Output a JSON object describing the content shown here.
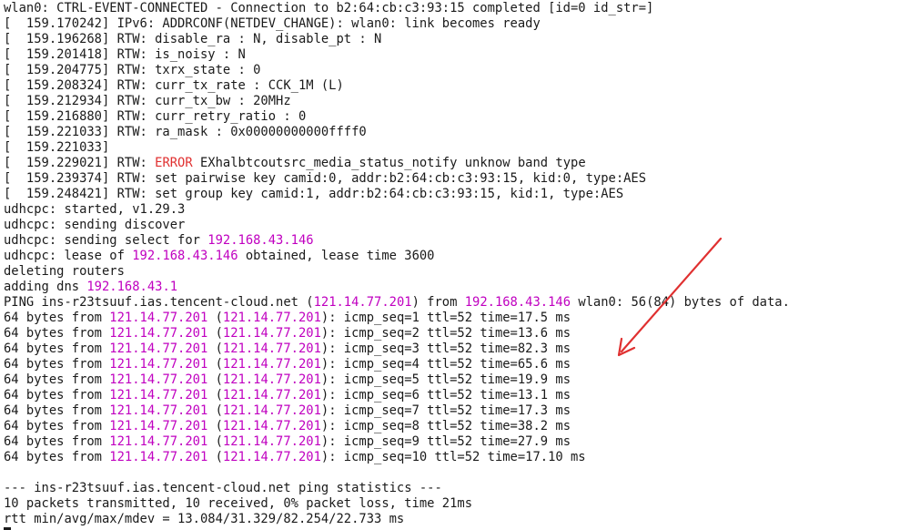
{
  "colors": {
    "text": "#1a1a1a",
    "ip_highlight": "#c000c0",
    "error": "#e03030",
    "arrow": "#e03030",
    "background": "#ffffff"
  },
  "terminal": {
    "lines": [
      [
        {
          "t": "wlan0: CTRL-EVENT-CONNECTED - Connection to b2:64:cb:c3:93:15 completed [id=0 id_str=]"
        }
      ],
      [
        {
          "t": "[  159.170242] IPv6: ADDRCONF(NETDEV_CHANGE): wlan0: link becomes ready"
        }
      ],
      [
        {
          "t": "[  159.196268] RTW: disable_ra : N, disable_pt : N"
        }
      ],
      [
        {
          "t": "[  159.201418] RTW: is_noisy : N"
        }
      ],
      [
        {
          "t": "[  159.204775] RTW: txrx_state : 0"
        }
      ],
      [
        {
          "t": "[  159.208324] RTW: curr_tx_rate : CCK_1M (L)"
        }
      ],
      [
        {
          "t": "[  159.212934] RTW: curr_tx_bw : 20MHz"
        }
      ],
      [
        {
          "t": "[  159.216880] RTW: curr_retry_ratio : 0"
        }
      ],
      [
        {
          "t": "[  159.221033] RTW: ra_mask : 0x00000000000ffff0"
        }
      ],
      [
        {
          "t": "[  159.221033]"
        }
      ],
      [
        {
          "t": "[  159.229021] RTW: "
        },
        {
          "t": "ERROR",
          "c": "error"
        },
        {
          "t": " EXhalbtcoutsrc_media_status_notify unknow band type"
        }
      ],
      [
        {
          "t": "[  159.239374] RTW: set pairwise key camid:0, addr:b2:64:cb:c3:93:15, kid:0, type:AES"
        }
      ],
      [
        {
          "t": "[  159.248421] RTW: set group key camid:1, addr:b2:64:cb:c3:93:15, kid:1, type:AES"
        }
      ],
      [
        {
          "t": "udhcpc: started, v1.29.3"
        }
      ],
      [
        {
          "t": "udhcpc: sending discover"
        }
      ],
      [
        {
          "t": "udhcpc: sending select for "
        },
        {
          "t": "192.168.43.146",
          "c": "ip"
        }
      ],
      [
        {
          "t": "udhcpc: lease of "
        },
        {
          "t": "192.168.43.146",
          "c": "ip"
        },
        {
          "t": " obtained, lease time 3600"
        }
      ],
      [
        {
          "t": "deleting routers"
        }
      ],
      [
        {
          "t": "adding dns "
        },
        {
          "t": "192.168.43.1",
          "c": "ip"
        }
      ],
      [
        {
          "t": "PING ins-r23tsuuf.ias.tencent-cloud.net ("
        },
        {
          "t": "121.14.77.201",
          "c": "ip"
        },
        {
          "t": ") from "
        },
        {
          "t": "192.168.43.146",
          "c": "ip"
        },
        {
          "t": " wlan0: 56(84) bytes of data."
        }
      ],
      [
        {
          "t": "64 bytes from "
        },
        {
          "t": "121.14.77.201",
          "c": "ip"
        },
        {
          "t": " ("
        },
        {
          "t": "121.14.77.201",
          "c": "ip"
        },
        {
          "t": "): icmp_seq=1 ttl=52 time=17.5 ms"
        }
      ],
      [
        {
          "t": "64 bytes from "
        },
        {
          "t": "121.14.77.201",
          "c": "ip"
        },
        {
          "t": " ("
        },
        {
          "t": "121.14.77.201",
          "c": "ip"
        },
        {
          "t": "): icmp_seq=2 ttl=52 time=13.6 ms"
        }
      ],
      [
        {
          "t": "64 bytes from "
        },
        {
          "t": "121.14.77.201",
          "c": "ip"
        },
        {
          "t": " ("
        },
        {
          "t": "121.14.77.201",
          "c": "ip"
        },
        {
          "t": "): icmp_seq=3 ttl=52 time=82.3 ms"
        }
      ],
      [
        {
          "t": "64 bytes from "
        },
        {
          "t": "121.14.77.201",
          "c": "ip"
        },
        {
          "t": " ("
        },
        {
          "t": "121.14.77.201",
          "c": "ip"
        },
        {
          "t": "): icmp_seq=4 ttl=52 time=65.6 ms"
        }
      ],
      [
        {
          "t": "64 bytes from "
        },
        {
          "t": "121.14.77.201",
          "c": "ip"
        },
        {
          "t": " ("
        },
        {
          "t": "121.14.77.201",
          "c": "ip"
        },
        {
          "t": "): icmp_seq=5 ttl=52 time=19.9 ms"
        }
      ],
      [
        {
          "t": "64 bytes from "
        },
        {
          "t": "121.14.77.201",
          "c": "ip"
        },
        {
          "t": " ("
        },
        {
          "t": "121.14.77.201",
          "c": "ip"
        },
        {
          "t": "): icmp_seq=6 ttl=52 time=13.1 ms"
        }
      ],
      [
        {
          "t": "64 bytes from "
        },
        {
          "t": "121.14.77.201",
          "c": "ip"
        },
        {
          "t": " ("
        },
        {
          "t": "121.14.77.201",
          "c": "ip"
        },
        {
          "t": "): icmp_seq=7 ttl=52 time=17.3 ms"
        }
      ],
      [
        {
          "t": "64 bytes from "
        },
        {
          "t": "121.14.77.201",
          "c": "ip"
        },
        {
          "t": " ("
        },
        {
          "t": "121.14.77.201",
          "c": "ip"
        },
        {
          "t": "): icmp_seq=8 ttl=52 time=38.2 ms"
        }
      ],
      [
        {
          "t": "64 bytes from "
        },
        {
          "t": "121.14.77.201",
          "c": "ip"
        },
        {
          "t": " ("
        },
        {
          "t": "121.14.77.201",
          "c": "ip"
        },
        {
          "t": "): icmp_seq=9 ttl=52 time=27.9 ms"
        }
      ],
      [
        {
          "t": "64 bytes from "
        },
        {
          "t": "121.14.77.201",
          "c": "ip"
        },
        {
          "t": " ("
        },
        {
          "t": "121.14.77.201",
          "c": "ip"
        },
        {
          "t": "): icmp_seq=10 ttl=52 time=17.10 ms"
        }
      ],
      [
        {
          "t": ""
        }
      ],
      [
        {
          "t": "--- ins-r23tsuuf.ias.tencent-cloud.net ping statistics ---"
        }
      ],
      [
        {
          "t": "10 packets transmitted, 10 received, 0% packet loss, time 21ms"
        }
      ],
      [
        {
          "t": "rtt min/avg/max/mdev = 13.084/31.329/82.254/22.733 ms"
        }
      ]
    ]
  }
}
